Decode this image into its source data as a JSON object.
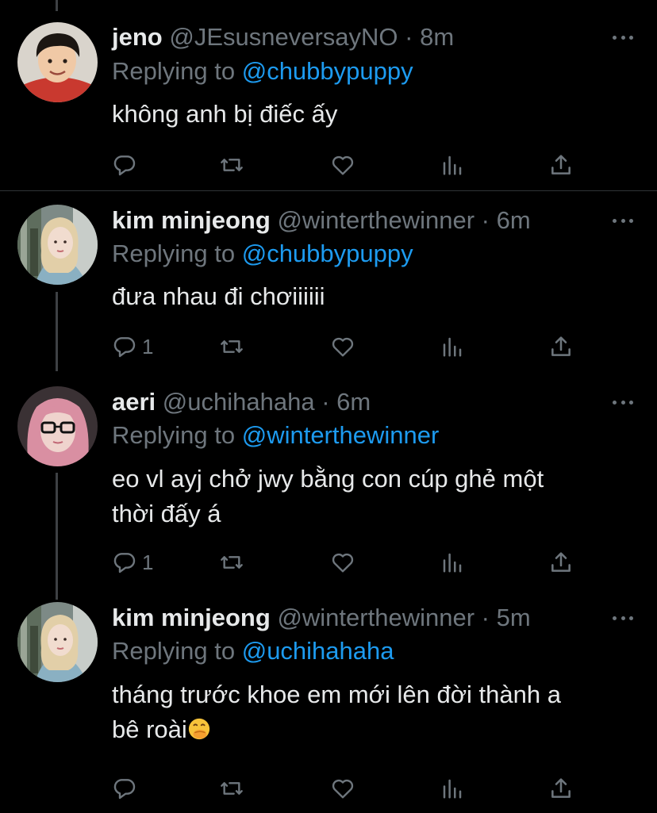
{
  "tweets": [
    {
      "name": "jeno",
      "handle": "@JEsusneversayNO",
      "separator": "·",
      "time": "8m",
      "replying_prefix": "Replying to",
      "replying_to": "@chubbypuppy",
      "text": "không anh bị điếc ấy",
      "text_line2": "",
      "reply_count": "",
      "avatar": "boy-smiling-avatar"
    },
    {
      "name": "kim minjeong",
      "handle": "@winterthewinner",
      "separator": "·",
      "time": "6m",
      "replying_prefix": "Replying to",
      "replying_to": "@chubbypuppy",
      "text": "đưa nhau đi chơiiiiii",
      "text_line2": "",
      "reply_count": "1",
      "avatar": "blonde-girl-avatar"
    },
    {
      "name": "aeri",
      "handle": "@uchihahaha",
      "separator": "·",
      "time": "6m",
      "replying_prefix": "Replying to",
      "replying_to": "@winterthewinner",
      "text": "eo vl ayj chở jwy bằng con cúp ghẻ một",
      "text_line2": "thời đấy á",
      "reply_count": "1",
      "avatar": "pink-hair-glasses-avatar"
    },
    {
      "name": "kim minjeong",
      "handle": "@winterthewinner",
      "separator": "·",
      "time": "5m",
      "replying_prefix": "Replying to",
      "replying_to": "@uchihahaha",
      "text": "tháng trước khoe em mới lên đời thành a",
      "text_line2": "bê roài",
      "reply_count": "",
      "avatar": "blonde-girl-avatar"
    }
  ],
  "icons": {
    "reply": "reply-icon",
    "retweet": "retweet-icon",
    "like": "heart-icon",
    "analytics": "analytics-icon",
    "share": "share-icon",
    "more": "more-options-icon",
    "emoji": "face-with-hand-over-mouth-emoji"
  },
  "colors": {
    "background": "#000000",
    "text": "#e7e9ea",
    "muted": "#6e767d",
    "link": "#1d9bf0",
    "divider": "#2f3336"
  }
}
